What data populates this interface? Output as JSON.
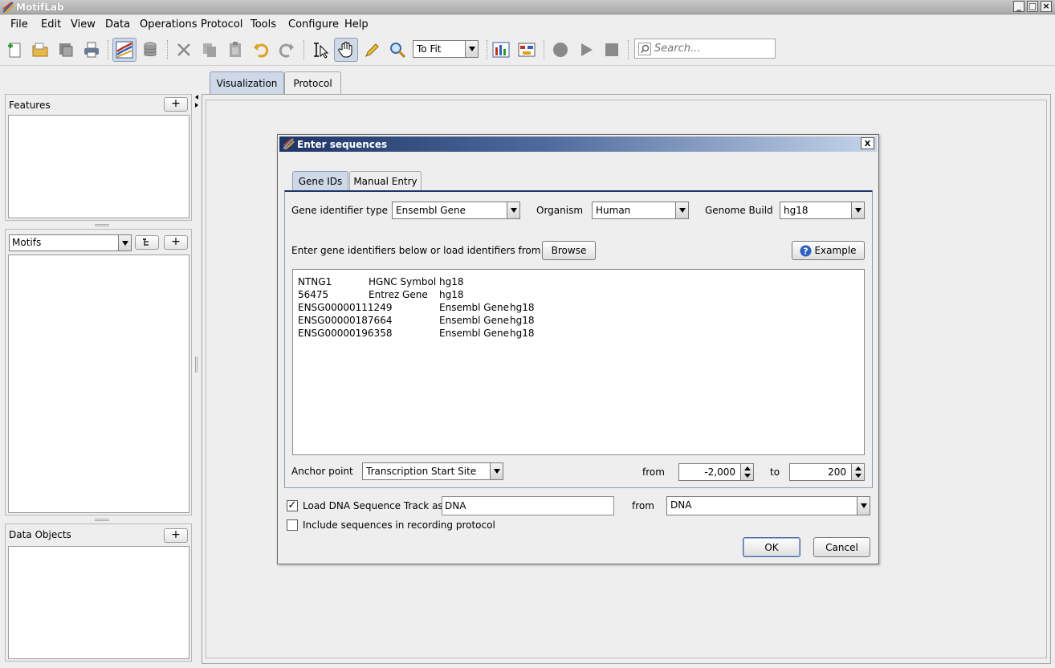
{
  "app": {
    "title": "MotifLab"
  },
  "menu": [
    "File",
    "Edit",
    "View",
    "Data",
    "Operations",
    "Protocol",
    "Tools",
    "Configure",
    "Help"
  ],
  "toolbar": {
    "zoom_value": "To Fit",
    "search_placeholder": "Search..."
  },
  "left_panels": {
    "features_title": "Features",
    "motifs_selector": "Motifs",
    "data_objects_title": "Data Objects",
    "add_symbol": "+"
  },
  "main_tabs": [
    "Visualization",
    "Protocol"
  ],
  "dialog": {
    "title": "Enter sequences",
    "close_symbol": "X",
    "tabs": [
      "Gene IDs",
      "Manual Entry"
    ],
    "gene_identifier_label": "Gene identifier type",
    "gene_identifier_value": "Ensembl Gene",
    "organism_label": "Organism",
    "organism_value": "Human",
    "genome_build_label": "Genome Build",
    "genome_build_value": "hg18",
    "instructions": "Enter gene identifiers below or load identifiers from file",
    "browse_button": "Browse",
    "example_button": "Example",
    "gene_rows": [
      [
        "NTNG1",
        "HGNC Symbol",
        "hg18"
      ],
      [
        "56475",
        "Entrez Gene",
        "hg18"
      ],
      [
        "ENSG00000111249",
        "Ensembl Gene",
        "hg18"
      ],
      [
        "ENSG00000187664",
        "Ensembl Gene",
        "hg18"
      ],
      [
        "ENSG00000196358",
        "Ensembl Gene",
        "hg18"
      ]
    ],
    "anchor_label": "Anchor point",
    "anchor_value": "Transcription Start Site",
    "from_label": "from",
    "from_value": "-2,000",
    "to_label": "to",
    "to_value": "200",
    "load_dna_label": "Load DNA Sequence Track as",
    "load_dna_checked": true,
    "load_dna_name": "DNA",
    "dna_from_label": "from",
    "dna_from_value": "DNA",
    "include_label": "Include sequences in recording protocol",
    "include_checked": false,
    "ok_button": "OK",
    "cancel_button": "Cancel"
  },
  "colors": {
    "dialog_title_start": "#1d3566",
    "selected_tab": "#cfd8e6"
  }
}
